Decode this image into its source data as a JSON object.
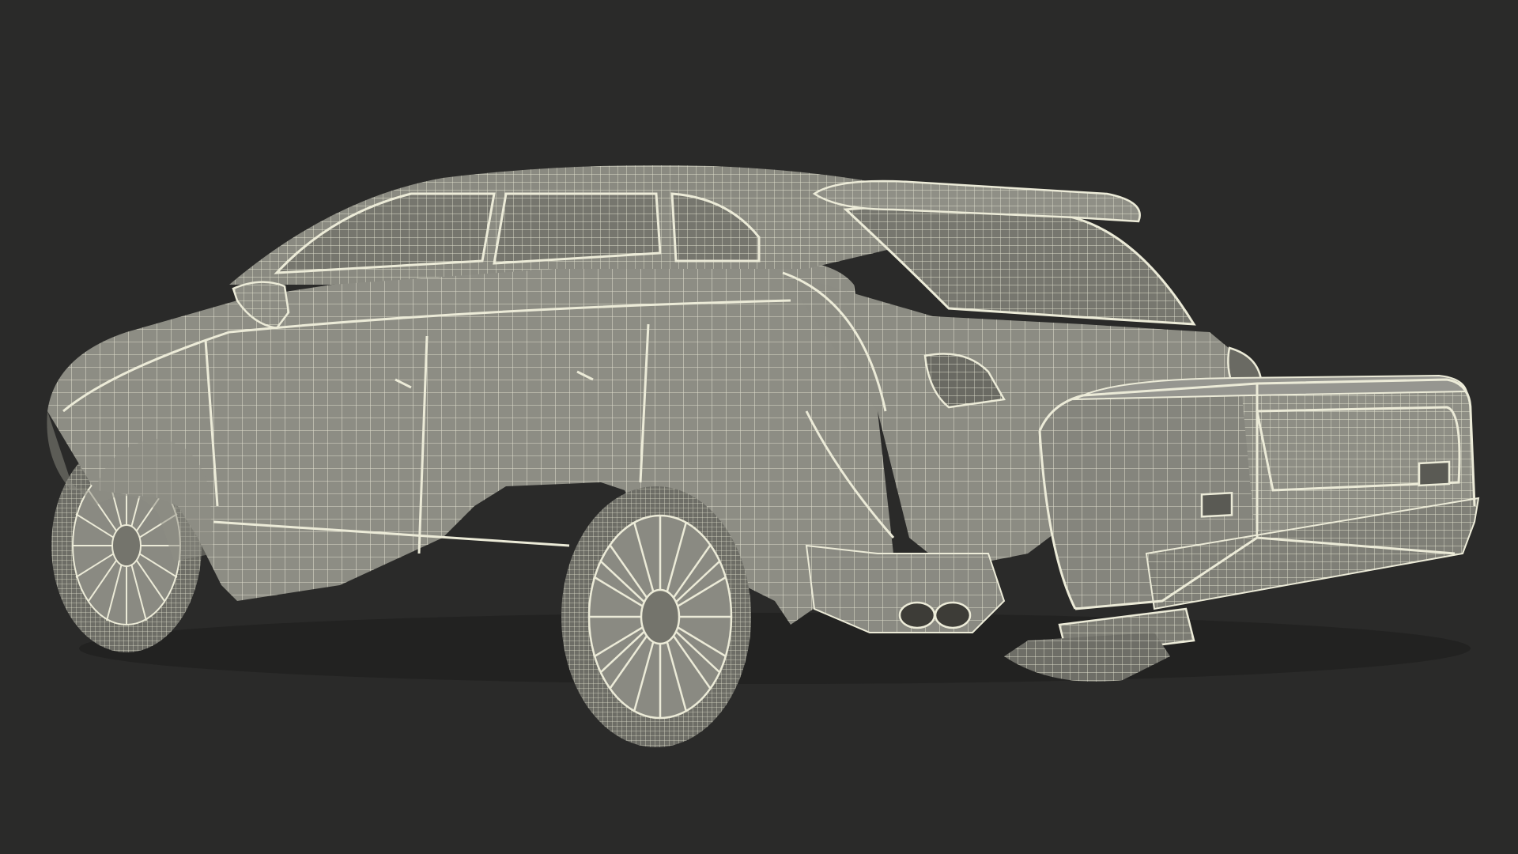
{
  "scene": {
    "subject": "suv-wireframe-with-hitch-cargo-box",
    "background_color": "#2a2a29",
    "surface_color": "#8d8d84",
    "surface_shadow_color": "#74746c",
    "wire_color": "#ecebd8",
    "dark_detail_color": "#3d3c37"
  }
}
